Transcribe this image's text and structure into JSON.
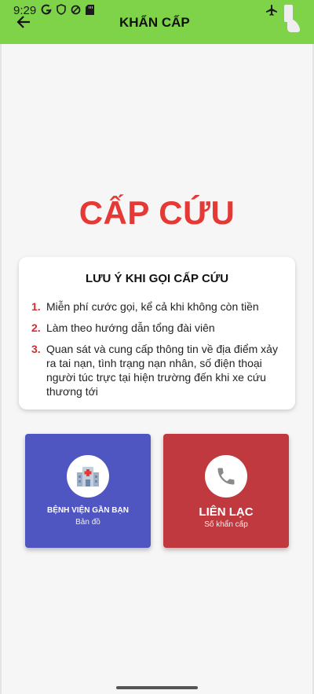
{
  "status_bar": {
    "time": "9:29",
    "icons": [
      "google-icon",
      "shield-icon",
      "data-saver-icon",
      "sd-card-icon",
      "airplane-icon",
      "battery-icon"
    ]
  },
  "header": {
    "title": "KHẨN CẤP",
    "background_color": "#7ed348"
  },
  "main": {
    "headline": "CẤP CỨU",
    "headline_color": "#e53935"
  },
  "notes": {
    "title": "LƯU Ý KHI GỌI CẤP CỨU",
    "items": [
      {
        "number": "1.",
        "text": "Miễn phí cước gọi, kể cả khi không còn tiền"
      },
      {
        "number": "2.",
        "text": "Làm theo hướng dẫn tổng đài viên"
      },
      {
        "number": "3.",
        "text": "Quan sát và cung cấp thông tin về địa điểm xảy ra tai nạn, tình trạng nạn nhân, số điện thoại người túc trực tại hiện trường đến khi xe cứu thương tới"
      }
    ]
  },
  "actions": {
    "hospital": {
      "title": "BỆNH VIỆN GẦN BẠN",
      "subtitle": "Bản đồ",
      "icon": "hospital-icon",
      "color": "#4f55c1"
    },
    "contact": {
      "title": "LIÊN LẠC",
      "subtitle": "Số khẩn cấp",
      "icon": "phone-icon",
      "color": "#c0393e"
    }
  }
}
